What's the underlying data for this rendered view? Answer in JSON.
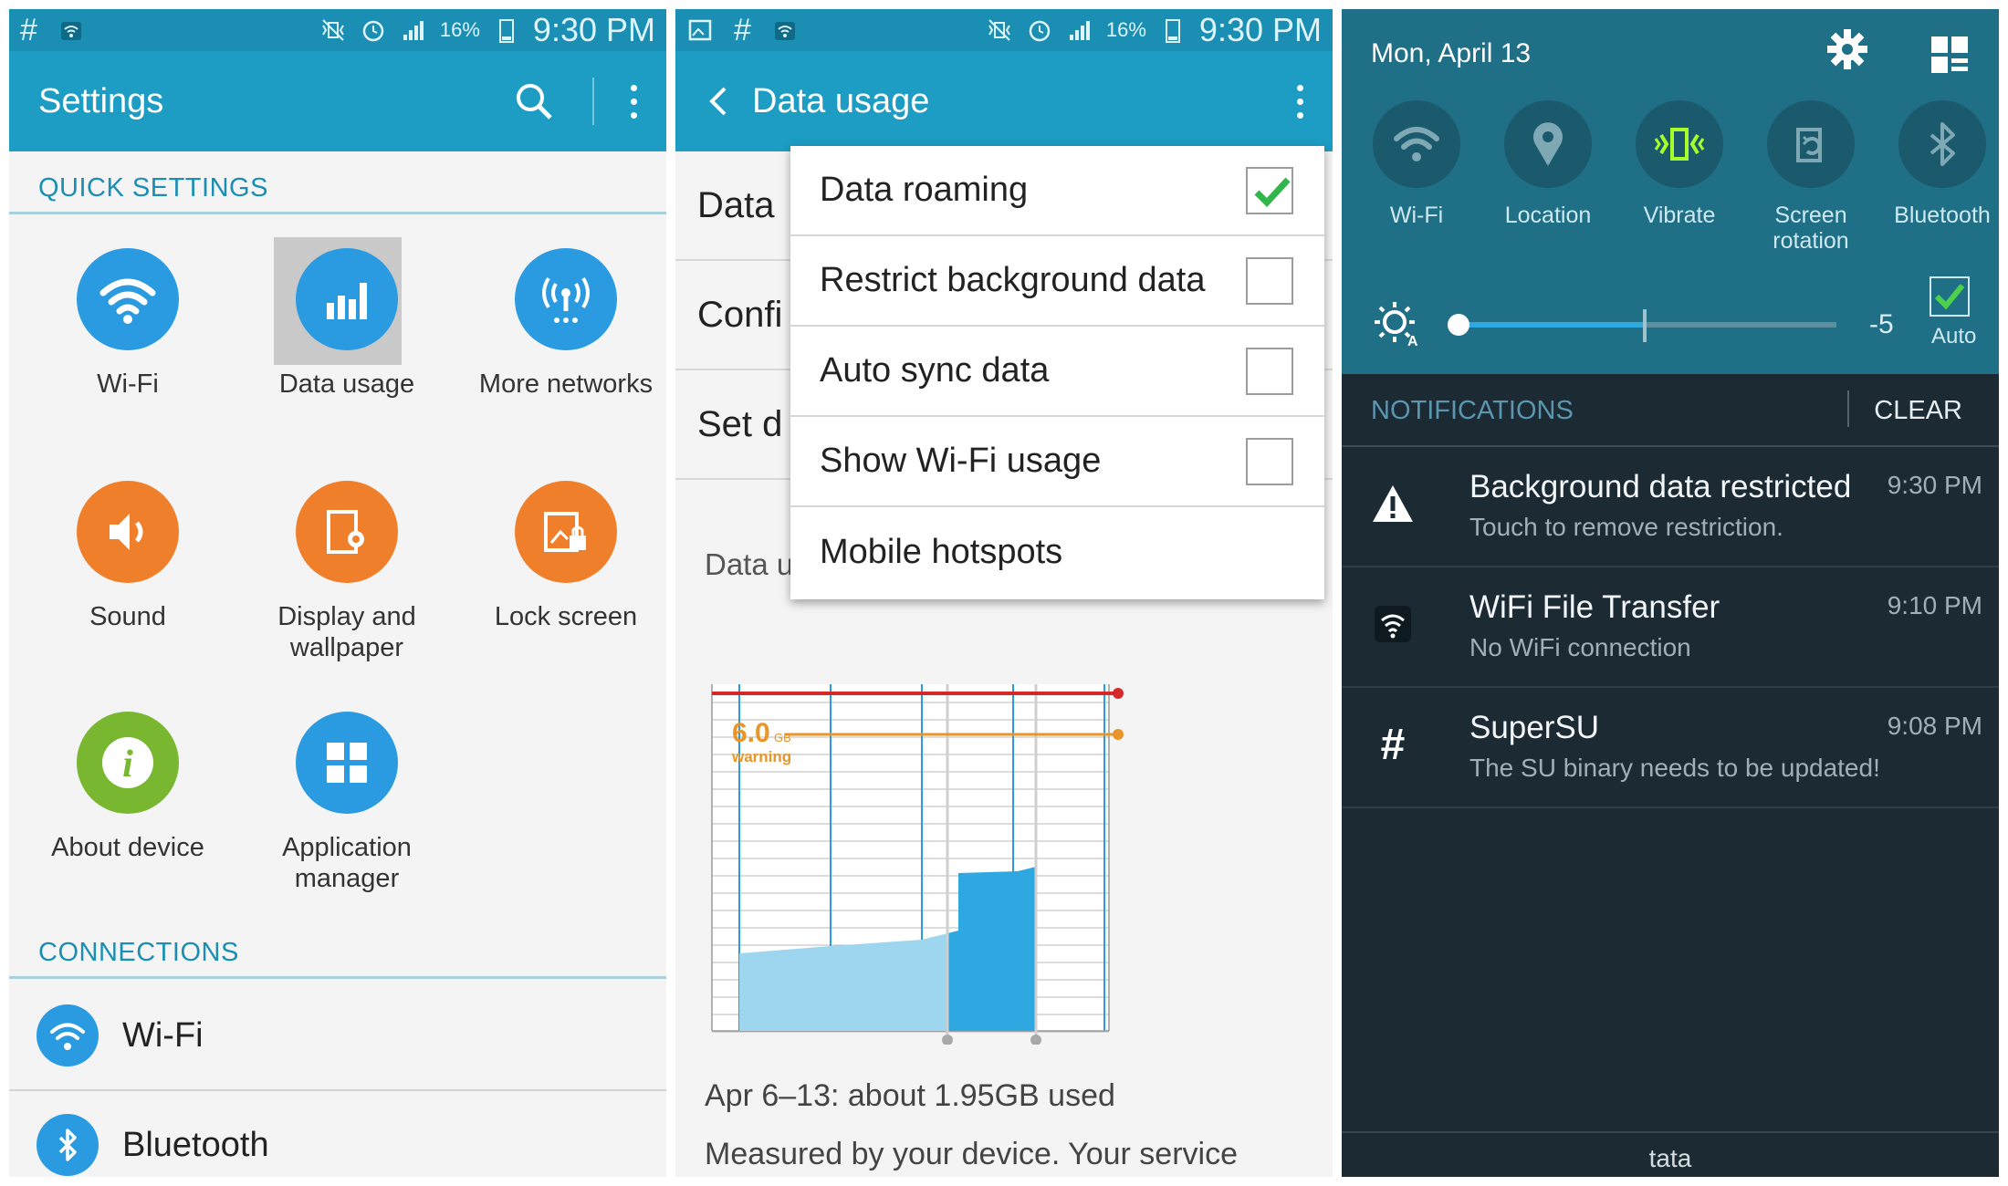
{
  "status_bar": {
    "battery": "16%",
    "time": "9:30 PM"
  },
  "settings": {
    "title": "Settings",
    "quick_settings_header": "QUICK SETTINGS",
    "quick_items": [
      {
        "label": "Wi-Fi",
        "icon": "wifi-icon"
      },
      {
        "label": "Data usage",
        "icon": "bar-chart-icon"
      },
      {
        "label": "More networks",
        "icon": "antenna-icon"
      },
      {
        "label": "Sound",
        "icon": "speaker-icon"
      },
      {
        "label": "Display and wallpaper",
        "icon": "display-icon"
      },
      {
        "label": "Lock screen",
        "icon": "lock-screen-icon"
      },
      {
        "label": "About device",
        "icon": "info-icon"
      },
      {
        "label": "Application manager",
        "icon": "grid-icon"
      }
    ],
    "connections_header": "CONNECTIONS",
    "connections": [
      {
        "label": "Wi-Fi",
        "icon": "wifi-icon"
      },
      {
        "label": "Bluetooth",
        "icon": "bluetooth-icon"
      }
    ]
  },
  "data_usage": {
    "title": "Data usage",
    "rows": [
      "Data",
      "Confi",
      "Set d"
    ],
    "sub_label": "Data u",
    "menu": [
      {
        "label": "Data roaming",
        "checked": true,
        "has_checkbox": true
      },
      {
        "label": "Restrict background data",
        "checked": false,
        "has_checkbox": true
      },
      {
        "label": "Auto sync data",
        "checked": false,
        "has_checkbox": true
      },
      {
        "label": "Show Wi-Fi usage",
        "checked": false,
        "has_checkbox": true
      },
      {
        "label": "Mobile hotspots",
        "checked": false,
        "has_checkbox": false
      }
    ],
    "warning_value": "6.0",
    "warning_unit": "GB",
    "warning_label": "warning",
    "usage_summary": "Apr 6–13: about 1.95GB used",
    "measured_text": "Measured by your device. Your service"
  },
  "panel": {
    "date": "Mon, April 13",
    "tiles": [
      {
        "label": "Wi-Fi",
        "icon": "wifi-icon",
        "active": false
      },
      {
        "label": "Location",
        "icon": "location-pin-icon",
        "active": false
      },
      {
        "label": "Vibrate",
        "icon": "vibrate-icon",
        "active": true
      },
      {
        "label": "Screen rotation",
        "icon": "screen-rotation-icon",
        "active": false
      },
      {
        "label": "Bluetooth",
        "icon": "bluetooth-icon",
        "active": false
      }
    ],
    "brightness_value": "-5",
    "brightness_level": 0.0,
    "auto_label": "Auto",
    "auto_checked": true,
    "notifications_header": "NOTIFICATIONS",
    "clear_label": "CLEAR",
    "notifications": [
      {
        "title": "Background data restricted",
        "body": "Touch to remove restriction.",
        "time": "9:30 PM",
        "icon": "warning-icon"
      },
      {
        "title": "WiFi File Transfer",
        "body": "No WiFi connection",
        "time": "9:10 PM",
        "icon": "wifi-icon"
      },
      {
        "title": "SuperSU",
        "body": "The SU binary needs to be updated!",
        "time": "9:08 PM",
        "icon": "hash-icon"
      }
    ],
    "carrier": "tata"
  },
  "colors": {
    "status_bar": "#1a8fb3",
    "action_bar": "#1d9cc4",
    "accent_blue": "#2a9be0",
    "accent_orange": "#f07f2b",
    "accent_green": "#79b731",
    "limit_red": "#d62828",
    "warning_orange": "#e8962a",
    "panel_teal": "#1f6f86",
    "panel_dark": "#1b2a33",
    "check_green": "#32b54a"
  }
}
